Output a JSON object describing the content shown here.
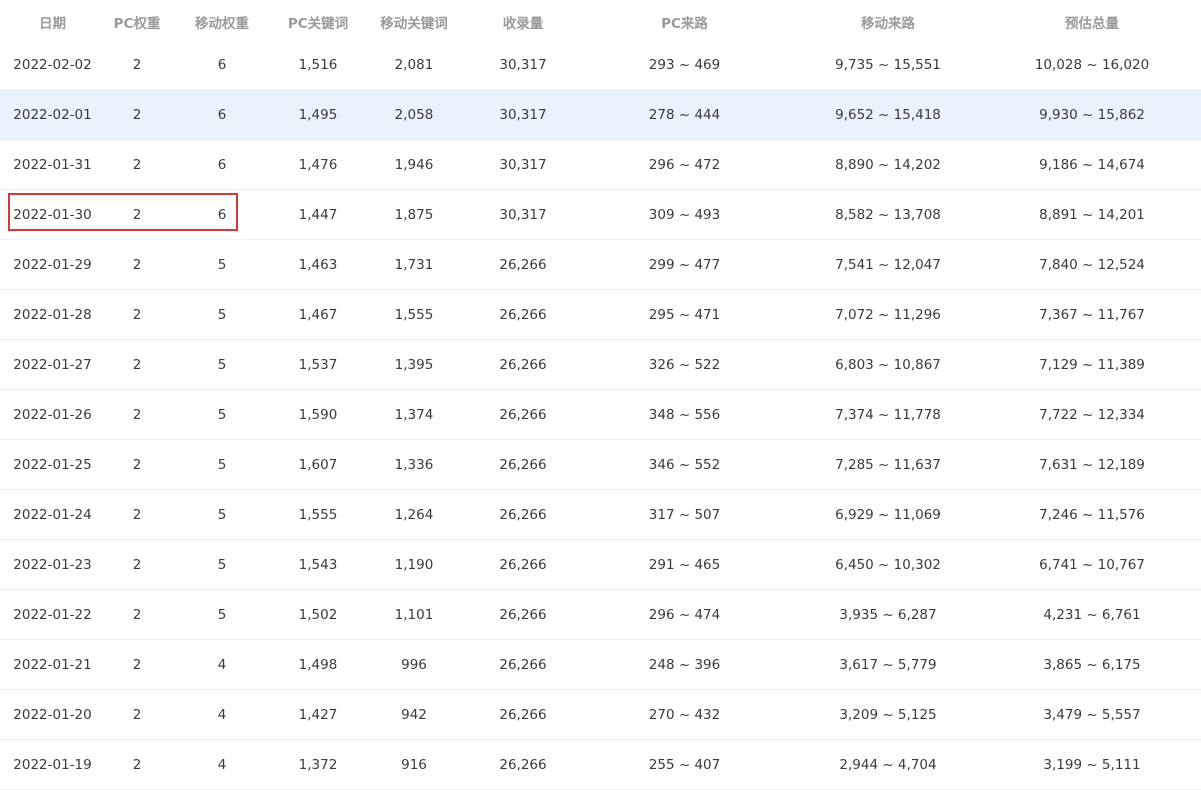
{
  "headers": {
    "date": "日期",
    "pc_weight": "PC权重",
    "mobile_weight": "移动权重",
    "pc_keywords": "PC关键词",
    "mobile_keywords": "移动关键词",
    "indexed": "收录量",
    "pc_source": "PC来路",
    "mobile_source": "移动来路",
    "estimated_total": "预估总量"
  },
  "rows": [
    {
      "date": "2022-02-02",
      "pc_weight": "2",
      "mobile_weight": "6",
      "pc_keywords": "1,516",
      "mobile_keywords": "2,081",
      "indexed": "30,317",
      "pc_source": "293 ~ 469",
      "mobile_source": "9,735 ~ 15,551",
      "estimated_total": "10,028 ~ 16,020"
    },
    {
      "date": "2022-02-01",
      "pc_weight": "2",
      "mobile_weight": "6",
      "pc_keywords": "1,495",
      "mobile_keywords": "2,058",
      "indexed": "30,317",
      "pc_source": "278 ~ 444",
      "mobile_source": "9,652 ~ 15,418",
      "estimated_total": "9,930 ~ 15,862"
    },
    {
      "date": "2022-01-31",
      "pc_weight": "2",
      "mobile_weight": "6",
      "pc_keywords": "1,476",
      "mobile_keywords": "1,946",
      "indexed": "30,317",
      "pc_source": "296 ~ 472",
      "mobile_source": "8,890 ~ 14,202",
      "estimated_total": "9,186 ~ 14,674"
    },
    {
      "date": "2022-01-30",
      "pc_weight": "2",
      "mobile_weight": "6",
      "pc_keywords": "1,447",
      "mobile_keywords": "1,875",
      "indexed": "30,317",
      "pc_source": "309 ~ 493",
      "mobile_source": "8,582 ~ 13,708",
      "estimated_total": "8,891 ~ 14,201"
    },
    {
      "date": "2022-01-29",
      "pc_weight": "2",
      "mobile_weight": "5",
      "pc_keywords": "1,463",
      "mobile_keywords": "1,731",
      "indexed": "26,266",
      "pc_source": "299 ~ 477",
      "mobile_source": "7,541 ~ 12,047",
      "estimated_total": "7,840 ~ 12,524"
    },
    {
      "date": "2022-01-28",
      "pc_weight": "2",
      "mobile_weight": "5",
      "pc_keywords": "1,467",
      "mobile_keywords": "1,555",
      "indexed": "26,266",
      "pc_source": "295 ~ 471",
      "mobile_source": "7,072 ~ 11,296",
      "estimated_total": "7,367 ~ 11,767"
    },
    {
      "date": "2022-01-27",
      "pc_weight": "2",
      "mobile_weight": "5",
      "pc_keywords": "1,537",
      "mobile_keywords": "1,395",
      "indexed": "26,266",
      "pc_source": "326 ~ 522",
      "mobile_source": "6,803 ~ 10,867",
      "estimated_total": "7,129 ~ 11,389"
    },
    {
      "date": "2022-01-26",
      "pc_weight": "2",
      "mobile_weight": "5",
      "pc_keywords": "1,590",
      "mobile_keywords": "1,374",
      "indexed": "26,266",
      "pc_source": "348 ~ 556",
      "mobile_source": "7,374 ~ 11,778",
      "estimated_total": "7,722 ~ 12,334"
    },
    {
      "date": "2022-01-25",
      "pc_weight": "2",
      "mobile_weight": "5",
      "pc_keywords": "1,607",
      "mobile_keywords": "1,336",
      "indexed": "26,266",
      "pc_source": "346 ~ 552",
      "mobile_source": "7,285 ~ 11,637",
      "estimated_total": "7,631 ~ 12,189"
    },
    {
      "date": "2022-01-24",
      "pc_weight": "2",
      "mobile_weight": "5",
      "pc_keywords": "1,555",
      "mobile_keywords": "1,264",
      "indexed": "26,266",
      "pc_source": "317 ~ 507",
      "mobile_source": "6,929 ~ 11,069",
      "estimated_total": "7,246 ~ 11,576"
    },
    {
      "date": "2022-01-23",
      "pc_weight": "2",
      "mobile_weight": "5",
      "pc_keywords": "1,543",
      "mobile_keywords": "1,190",
      "indexed": "26,266",
      "pc_source": "291 ~ 465",
      "mobile_source": "6,450 ~ 10,302",
      "estimated_total": "6,741 ~ 10,767"
    },
    {
      "date": "2022-01-22",
      "pc_weight": "2",
      "mobile_weight": "5",
      "pc_keywords": "1,502",
      "mobile_keywords": "1,101",
      "indexed": "26,266",
      "pc_source": "296 ~ 474",
      "mobile_source": "3,935 ~ 6,287",
      "estimated_total": "4,231 ~ 6,761"
    },
    {
      "date": "2022-01-21",
      "pc_weight": "2",
      "mobile_weight": "4",
      "pc_keywords": "1,498",
      "mobile_keywords": "996",
      "indexed": "26,266",
      "pc_source": "248 ~ 396",
      "mobile_source": "3,617 ~ 5,779",
      "estimated_total": "3,865 ~ 6,175"
    },
    {
      "date": "2022-01-20",
      "pc_weight": "2",
      "mobile_weight": "4",
      "pc_keywords": "1,427",
      "mobile_keywords": "942",
      "indexed": "26,266",
      "pc_source": "270 ~ 432",
      "mobile_source": "3,209 ~ 5,125",
      "estimated_total": "3,479 ~ 5,557"
    },
    {
      "date": "2022-01-19",
      "pc_weight": "2",
      "mobile_weight": "4",
      "pc_keywords": "1,372",
      "mobile_keywords": "916",
      "indexed": "26,266",
      "pc_source": "255 ~ 407",
      "mobile_source": "2,944 ~ 4,704",
      "estimated_total": "3,199 ~ 5,111"
    }
  ],
  "highlighted_row_index": 1,
  "boxed_row_index": 3,
  "colors": {
    "header_text": "#9a9a9a",
    "row_text": "#3a3a3a",
    "hover_row_bg": "#eaf2fd",
    "annotation_box": "#d13a36"
  }
}
